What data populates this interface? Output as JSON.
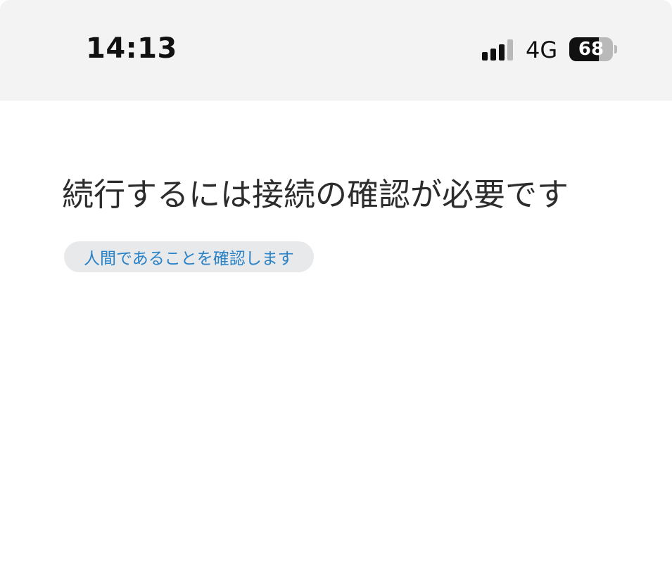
{
  "status_bar": {
    "time": "14:13",
    "network": "4G",
    "battery_level": "68",
    "battery_fraction": 0.68,
    "signal_bars_active": 3,
    "signal_bars_total": 4
  },
  "main": {
    "heading": "続行するには接続の確認が必要です",
    "verify_button_label": "人間であることを確認します"
  },
  "colors": {
    "status_bar_bg": "#f3f3f3",
    "link_blue": "#2a82c7",
    "button_bg": "#e8e9eb",
    "text_dark": "#2c2c2c"
  }
}
